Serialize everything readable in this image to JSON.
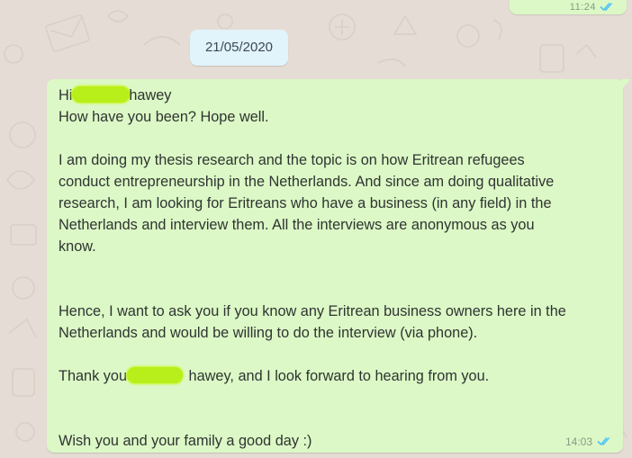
{
  "chat": {
    "previous_message": {
      "time": "11:24"
    },
    "date_divider": "21/05/2020",
    "message": {
      "greeting_prefix": "Hi",
      "greeting_suffix": "hawey",
      "lines_1": [
        "How have you been? Hope well."
      ],
      "lines_2": [
        "I am doing my thesis research and the topic is on how Eritrean refugees",
        "conduct entrepreneurship in the Netherlands. And since am doing qualitative",
        "research, I am looking for Eritreans who have a business (in any field) in the",
        "Netherlands and interview them. All the interviews are anonymous as you",
        "know."
      ],
      "lines_3": [
        "Hence, I want to ask you if you know any Eritrean business owners here in the",
        "Netherlands and would be willing to do the interview (via phone)."
      ],
      "thanks_prefix": "Thank you",
      "thanks_suffix": " hawey, and I look forward to hearing from you.",
      "closing": "Wish you and your family a good day :)",
      "time": "14:03",
      "status": "read"
    }
  },
  "colors": {
    "chat_background": "#e5ddd5",
    "outgoing_bubble": "#dcf8c6",
    "date_chip": "#e1f3fb",
    "read_ticks": "#4fc3f7",
    "redaction_highlight": "#b8ef1a"
  },
  "icons": {
    "read_status": "double-check-icon"
  }
}
